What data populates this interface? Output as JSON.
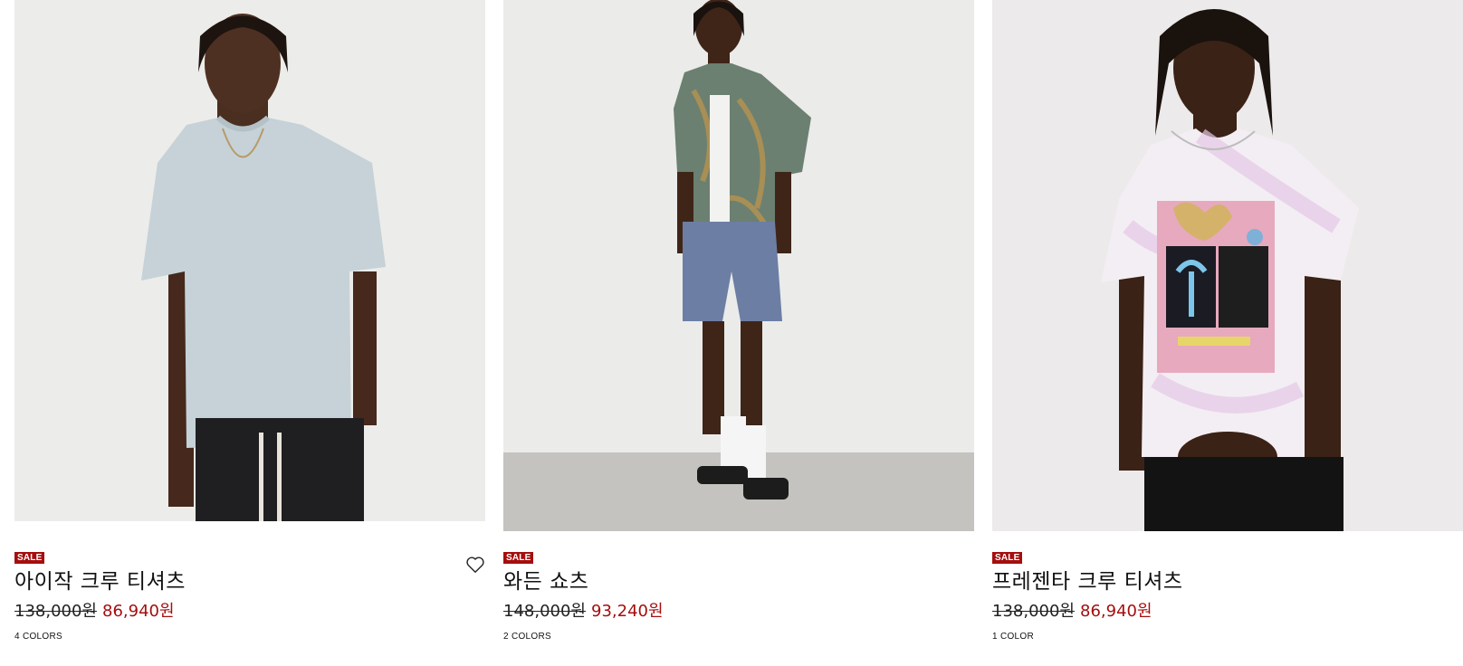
{
  "products": [
    {
      "badge": "SALE",
      "name": "아이작 크루 티셔츠",
      "original_price": "138,000원",
      "sale_price": "86,940원",
      "colors": "4 COLORS"
    },
    {
      "badge": "SALE",
      "name": "와든 쇼츠",
      "original_price": "148,000원",
      "sale_price": "93,240원",
      "colors": "2 COLORS"
    },
    {
      "badge": "SALE",
      "name": "프레젠타 크루 티셔츠",
      "original_price": "138,000원",
      "sale_price": "86,940원",
      "colors": "1 COLOR"
    }
  ],
  "colors": {
    "sale_badge_bg": "#a50e0e",
    "sale_price": "#a50e0e",
    "text": "#111111"
  },
  "icons": {
    "wishlist": "heart-outline-icon"
  }
}
